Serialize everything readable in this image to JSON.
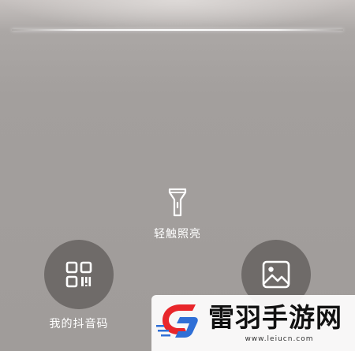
{
  "scanner": {
    "torch_label": "轻触照亮",
    "qr_code_label": "我的抖音码",
    "background_color": "#a39f9d",
    "button_color": "#6f6b69"
  },
  "watermark": {
    "title": "雷羽手游网",
    "url": "www.leiucn.com"
  }
}
